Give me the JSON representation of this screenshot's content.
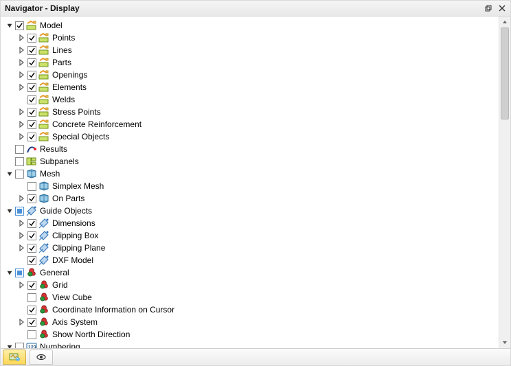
{
  "title": "Navigator - Display",
  "tree": [
    {
      "id": "model",
      "depth": 0,
      "expander": "open",
      "checkbox": "checked",
      "icon": "model-icon",
      "label": "Model"
    },
    {
      "id": "points",
      "depth": 1,
      "expander": "closed",
      "checkbox": "checked",
      "icon": "model-icon",
      "label": "Points"
    },
    {
      "id": "lines",
      "depth": 1,
      "expander": "closed",
      "checkbox": "checked",
      "icon": "model-icon",
      "label": "Lines"
    },
    {
      "id": "parts",
      "depth": 1,
      "expander": "closed",
      "checkbox": "checked",
      "icon": "model-icon",
      "label": "Parts"
    },
    {
      "id": "openings",
      "depth": 1,
      "expander": "closed",
      "checkbox": "checked",
      "icon": "model-icon",
      "label": "Openings"
    },
    {
      "id": "elements",
      "depth": 1,
      "expander": "closed",
      "checkbox": "checked",
      "icon": "model-icon",
      "label": "Elements"
    },
    {
      "id": "welds",
      "depth": 1,
      "expander": "none",
      "checkbox": "checked",
      "icon": "model-icon",
      "label": "Welds"
    },
    {
      "id": "stress-points",
      "depth": 1,
      "expander": "closed",
      "checkbox": "checked",
      "icon": "model-icon",
      "label": "Stress Points"
    },
    {
      "id": "concrete-reinforcement",
      "depth": 1,
      "expander": "closed",
      "checkbox": "checked",
      "icon": "model-icon",
      "label": "Concrete Reinforcement"
    },
    {
      "id": "special-objects",
      "depth": 1,
      "expander": "closed",
      "checkbox": "checked",
      "icon": "model-icon",
      "label": "Special Objects"
    },
    {
      "id": "results",
      "depth": 1,
      "expander": "none",
      "checkbox": "unchecked",
      "icon": "results-icon",
      "label": "Results",
      "noindent_expander": true
    },
    {
      "id": "subpanels",
      "depth": 1,
      "expander": "none",
      "checkbox": "unchecked",
      "icon": "subpanels-icon",
      "label": "Subpanels",
      "noindent_expander": true
    },
    {
      "id": "mesh",
      "depth": 0,
      "expander": "open",
      "checkbox": "unchecked",
      "icon": "mesh-icon",
      "label": "Mesh"
    },
    {
      "id": "simplex-mesh",
      "depth": 1,
      "expander": "none",
      "checkbox": "unchecked",
      "icon": "mesh-icon",
      "label": "Simplex Mesh"
    },
    {
      "id": "on-parts",
      "depth": 1,
      "expander": "closed",
      "checkbox": "checked",
      "icon": "mesh-icon",
      "label": "On Parts"
    },
    {
      "id": "guide-objects",
      "depth": 0,
      "expander": "open",
      "checkbox": "partial",
      "icon": "guide-icon",
      "label": "Guide Objects"
    },
    {
      "id": "dimensions",
      "depth": 1,
      "expander": "closed",
      "checkbox": "checked",
      "icon": "guide-icon",
      "label": "Dimensions"
    },
    {
      "id": "clipping-box",
      "depth": 1,
      "expander": "closed",
      "checkbox": "checked",
      "icon": "guide-icon",
      "label": "Clipping Box"
    },
    {
      "id": "clipping-plane",
      "depth": 1,
      "expander": "closed",
      "checkbox": "checked",
      "icon": "guide-icon",
      "label": "Clipping Plane"
    },
    {
      "id": "dxf-model",
      "depth": 1,
      "expander": "none",
      "checkbox": "checked",
      "icon": "guide-icon",
      "label": "DXF Model"
    },
    {
      "id": "general",
      "depth": 0,
      "expander": "open",
      "checkbox": "partial",
      "icon": "general-icon",
      "label": "General"
    },
    {
      "id": "grid",
      "depth": 1,
      "expander": "closed",
      "checkbox": "checked",
      "icon": "general-icon",
      "label": "Grid"
    },
    {
      "id": "view-cube",
      "depth": 1,
      "expander": "none",
      "checkbox": "unchecked",
      "icon": "general-icon",
      "label": "View Cube"
    },
    {
      "id": "coord-cursor",
      "depth": 1,
      "expander": "none",
      "checkbox": "checked",
      "icon": "general-icon",
      "label": "Coordinate Information on Cursor"
    },
    {
      "id": "axis-system",
      "depth": 1,
      "expander": "closed",
      "checkbox": "checked",
      "icon": "general-icon",
      "label": "Axis System"
    },
    {
      "id": "north",
      "depth": 1,
      "expander": "none",
      "checkbox": "unchecked",
      "icon": "general-icon",
      "label": "Show North Direction"
    },
    {
      "id": "numbering",
      "depth": 0,
      "expander": "open",
      "checkbox": "unchecked",
      "icon": "numbering-icon",
      "label": "Numbering"
    }
  ],
  "tabs": {
    "display_tab": "Display",
    "view_tab": "View"
  }
}
